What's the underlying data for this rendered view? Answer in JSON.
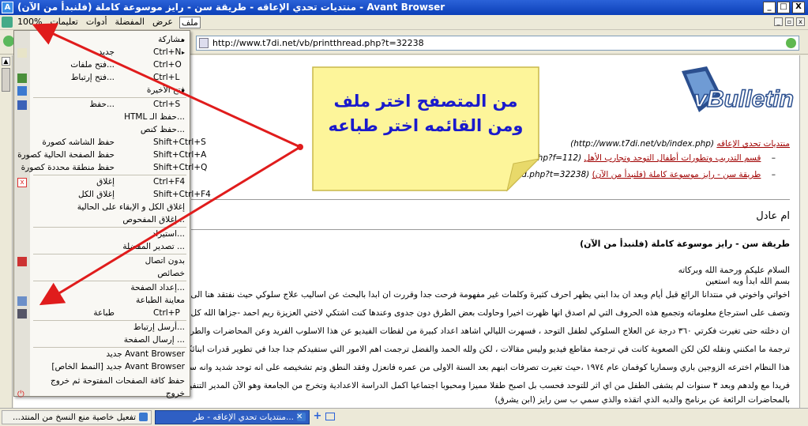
{
  "titlebar": {
    "title": "(منتديات تحدي الإعاقه - طريقة سن - رايز موسوعة كاملة (فلنبدأ من الآن - Avant Browser",
    "minimize": "_",
    "maximize": "□",
    "close": "X"
  },
  "menubar": {
    "items": [
      "ملف",
      "عرض",
      "المفضلة",
      "أدوات",
      "تعليمات",
      "100%"
    ],
    "active": "ملف"
  },
  "address": {
    "url": "http://www.t7di.net/vb/printthread.php?t=32238"
  },
  "file_menu": {
    "items": [
      {
        "label": "مشاركة",
        "shortcut": "",
        "submenu": true,
        "icon": ""
      },
      {
        "label": "جديد",
        "shortcut": "Ctrl+N",
        "submenu": true,
        "icon": "new-doc-icon"
      },
      {
        "label": "...فتح ملفات",
        "shortcut": "Ctrl+O",
        "submenu": false,
        "icon": ""
      },
      {
        "label": "...فتح إرتباط",
        "shortcut": "Ctrl+L",
        "submenu": false,
        "icon": "open-link-icon"
      },
      {
        "label": "فتح الأخيرة",
        "shortcut": "",
        "submenu": true,
        "icon": "recent-icon"
      },
      {
        "label": "...حفظ",
        "shortcut": "Ctrl+S",
        "submenu": false,
        "icon": "save-icon"
      },
      {
        "label": "...حفظ الـ HTML",
        "shortcut": "",
        "submenu": false,
        "icon": ""
      },
      {
        "label": "...حفظ كنص",
        "shortcut": "",
        "submenu": false,
        "icon": ""
      },
      {
        "label": "حفظ الشاشه كصورة",
        "shortcut": "Shift+Ctrl+S",
        "submenu": false,
        "icon": ""
      },
      {
        "label": "حفظ الصفحة الحالية كصورة",
        "shortcut": "Shift+Ctrl+A",
        "submenu": false,
        "icon": ""
      },
      {
        "label": "حفظ منطقة محددة كصورة",
        "shortcut": "Shift+Ctrl+Q",
        "submenu": false,
        "icon": ""
      },
      {
        "label": "إغلاق",
        "shortcut": "Ctrl+F4",
        "submenu": false,
        "icon": "close-x-icon"
      },
      {
        "label": "إغلاق الكل",
        "shortcut": "Shift+Ctrl+F4",
        "submenu": false,
        "icon": ""
      },
      {
        "label": "إغلاق الكل و الإبقاء على الحالية",
        "shortcut": "",
        "submenu": false,
        "icon": ""
      },
      {
        "label": "...إغلاق المفحوص",
        "shortcut": "",
        "submenu": false,
        "icon": ""
      },
      {
        "label": "...استيراد",
        "shortcut": "",
        "submenu": false,
        "icon": ""
      },
      {
        "label": "... تصدير المفضلة",
        "shortcut": "",
        "submenu": false,
        "icon": ""
      },
      {
        "label": "بدون اتصال",
        "shortcut": "",
        "submenu": false,
        "icon": "offline-icon"
      },
      {
        "label": "خصائص",
        "shortcut": "",
        "submenu": false,
        "icon": ""
      },
      {
        "label": "...إعداد الصفحة",
        "shortcut": "",
        "submenu": false,
        "icon": ""
      },
      {
        "label": "معاينة الطباعة",
        "shortcut": "",
        "submenu": false,
        "icon": "print-preview-icon"
      },
      {
        "label": "طباعة",
        "shortcut": "Ctrl+P",
        "submenu": false,
        "icon": "print-icon"
      },
      {
        "label": "...أرسل إرتباط",
        "shortcut": "",
        "submenu": false,
        "icon": ""
      },
      {
        "label": "... إرسال الصفحة",
        "shortcut": "",
        "submenu": false,
        "icon": ""
      },
      {
        "label": "Avant Browser جديد",
        "shortcut": "",
        "submenu": false,
        "icon": ""
      },
      {
        "label": "Avant Browser جديد [النمط الخاص]",
        "shortcut": "",
        "submenu": false,
        "icon": ""
      },
      {
        "label": "حفظ كافة الصفحات المفتوحة ثم خروج",
        "shortcut": "",
        "submenu": false,
        "icon": ""
      },
      {
        "label": "خروج",
        "shortcut": "",
        "submenu": false,
        "icon": "power-icon"
      }
    ]
  },
  "callout": {
    "text": "من المتصفح اختر ملف ومن القائمه اختر طباعه",
    "text_color": "#1a1acc",
    "fill_color": "#fdf59a"
  },
  "page": {
    "logo_text": "vBulletin",
    "crumbs": [
      {
        "link": "منتديات تحدي الإعاقه",
        "url": "(http://www.t7di.net/vb/index.php)"
      },
      {
        "link": "قسم التدريب وتطورات أطفال التوحد وتجارب الأهل",
        "url": "(...rumdisplay.php?f=112)"
      },
      {
        "link": "طريقة سن - رايز موسوعة كاملة (فلنبدأ من الآن)",
        "url": "(...ead.php?t=32238)"
      }
    ],
    "author": "ام عادل",
    "post_title": "طريقة سن - رايز موسوعة كاملة (فلنبدأ من الآن)",
    "lines": [
      "السلام عليكم ورحمة الله وبركاته",
      "بسم الله ابدأ وبه استعين",
      "اخواتي واخوتي في منتدانا الرائع قبل أيام وبعد ان بدا ابني يظهر احرف كثيرة وكلمات غير مفهومة فرحت جدا وقررت ان ابدا بالبحث عن اساليب علاج سلوكي حيث نفتقد هنا الى الاخصائيين في",
      "وتصف على استرجاع معلوماته وتجميع هذه الحروف التي لم اصدق انها ظهرت اخيرا وحاولت بعض الطرق دون جدوى وعندها كنت اشتكي لاختي العزيزة ريم احمد -جزاها الله كل خير- عن ردود",
      "ان دخلته حتى تغيرت فكرتي ٣٦٠ درجة عن العلاج السلوكي لطفل التوحد ، فسهرت الليالي اشاهد اعداد كبيرة من لقطات الفيديو عن هذا الاسلوب الفريد وعن المحاضرات والطرق التي تمكن الا",
      "ترجمة ما امكنني ونقله لكن لكن الصعوبة كانت في ترجمة مقاطع فيديو وليس مقالات ، لكن ولله الحمد والفضل ترجمت اهم الامور التي ستفيدكم جدا جدا في تطوير قدرات ابنائكم باذن الله تعالى.",
      "هذا النظام اخترعه الزوجين باري وسماريا كوفمان عام ١٩٧٤ ،حيث تغيرت تصرفات ابنهم بعد السنة الاولى من عمره فانعزل وفقد النطق وتم تشخيصه على انه توحد شديد وانه سيبقى عاجزا مدى",
      "فريدا مع ولدهم وبعد ٣ سنوات لم يشفى الطفل من اي اثر للتوحد فحسب بل اصبح طفلا مميزا ومحبوبا اجتماعيا اكمل الدراسة الاعدادية وتخرج من الجامعة وهو الآن المدير التنفيذي لاهم مراكز",
      "بالمحاضرات الرائعة عن برنامج والديه الذي اتقذه والذي سمي ب سن رايز (ابن يشرق)"
    ]
  },
  "taskbar": {
    "tabs": [
      {
        "label": "تفعيل خاصية منع النسخ من المنتد...",
        "active": false
      },
      {
        "label": "...منتديات تحدي الإعاقه - طر",
        "active": true
      }
    ]
  },
  "colors": {
    "title_bar": "#2b62d8",
    "arrow": "#e01c1c",
    "link": "#a00000"
  }
}
